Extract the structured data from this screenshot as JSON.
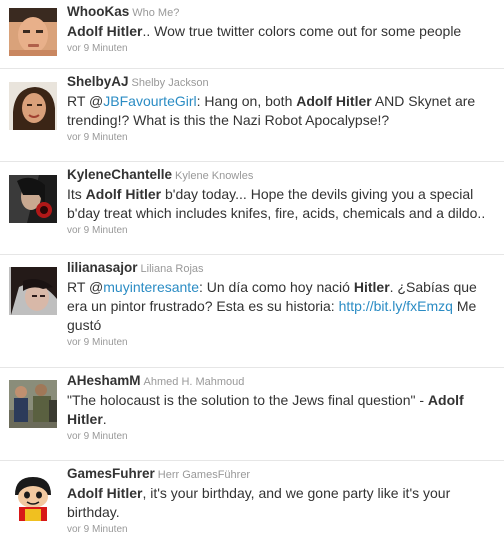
{
  "tweets": [
    {
      "screen_name": "WhooKas",
      "full_name": "Who Me?",
      "segments": [
        {
          "type": "bold",
          "text": "Adolf Hitler"
        },
        {
          "type": "text",
          "text": ".. Wow true twitter colors come out for some people"
        }
      ],
      "time": "vor 9 Minuten",
      "avatar_icon": "face-photo-icon"
    },
    {
      "screen_name": "ShelbyAJ",
      "full_name": "Shelby Jackson",
      "segments": [
        {
          "type": "text",
          "text": "RT @"
        },
        {
          "type": "mention",
          "text": "JBFavourteGirl"
        },
        {
          "type": "text",
          "text": ": Hang on, both "
        },
        {
          "type": "bold",
          "text": "Adolf Hitler"
        },
        {
          "type": "text",
          "text": " AND Skynet are trending!? What is this the Nazi Robot Apocalypse!?"
        }
      ],
      "time": "vor 9 Minuten",
      "avatar_icon": "face-photo-icon"
    },
    {
      "screen_name": "KyleneChantelle",
      "full_name": "Kylene Knowles",
      "segments": [
        {
          "type": "text",
          "text": "Its "
        },
        {
          "type": "bold",
          "text": "Adolf Hitler"
        },
        {
          "type": "text",
          "text": " b'day today... Hope the devils giving you a special b'day treat which includes knifes, fire, acids, chemicals and a dildo.."
        }
      ],
      "time": "vor 9 Minuten",
      "avatar_icon": "dark-photo-icon"
    },
    {
      "screen_name": "lilianasajor",
      "full_name": "Liliana Rojas",
      "segments": [
        {
          "type": "text",
          "text": "RT @"
        },
        {
          "type": "mention",
          "text": "muyinteresante"
        },
        {
          "type": "text",
          "text": ": Un día como hoy nació "
        },
        {
          "type": "bold",
          "text": "Hitler"
        },
        {
          "type": "text",
          "text": ". ¿Sabías que era un pintor frustrado? Esta es su historia: "
        },
        {
          "type": "link",
          "text": "http://bit.ly/fxEmzq"
        },
        {
          "type": "text",
          "text": " Me gustó"
        }
      ],
      "time": "vor 9 Minuten",
      "avatar_icon": "face-photo-icon"
    },
    {
      "screen_name": "AHeshamM",
      "full_name": "Ahmed H. Mahmoud",
      "segments": [
        {
          "type": "text",
          "text": "\"The holocaust is the solution to the Jews final question\" - "
        },
        {
          "type": "bold",
          "text": "Adolf Hitler"
        },
        {
          "type": "text",
          "text": "."
        }
      ],
      "time": "vor 9 Minuten",
      "avatar_icon": "people-photo-icon"
    },
    {
      "screen_name": "GamesFuhrer",
      "full_name": "Herr GamesFührer",
      "segments": [
        {
          "type": "bold",
          "text": "Adolf Hitler"
        },
        {
          "type": "text",
          "text": ", it's your birthday, and we gone party like it's your birthday."
        }
      ],
      "time": "vor 9 Minuten",
      "avatar_icon": "cartoon-character-icon"
    }
  ],
  "colors": {
    "link": "#2b8cc4",
    "muted": "#999999",
    "text": "#333333",
    "divider": "#e6e6e6"
  }
}
